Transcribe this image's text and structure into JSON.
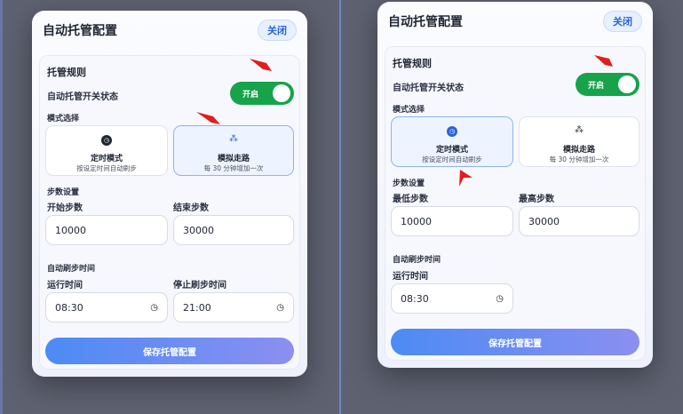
{
  "panels": [
    {
      "title": "自动托管配置",
      "close_label": "关闭",
      "rule_title": "托管规则",
      "switch_label": "自动托管开关状态",
      "switch_text": "开启",
      "mode_label": "模式选择",
      "modes": [
        {
          "name": "定时模式",
          "desc": "按设定时间自动刷步",
          "icon": "clock-icon"
        },
        {
          "name": "模拟走路",
          "desc": "每 30 分钟增加一次",
          "icon": "footsteps-icon"
        }
      ],
      "selected_mode": "模拟走路",
      "steps_title": "步数设置",
      "start_label": "开始步数",
      "start_value": "10000",
      "end_label": "结束步数",
      "end_value": "30000",
      "time_title": "自动刷步时间",
      "run_label": "运行时间",
      "run_value": "08:30",
      "stop_label": "停止刷步时间",
      "stop_value": "21:00",
      "save_label": "保存托管配置"
    },
    {
      "title": "自动托管配置",
      "close_label": "关闭",
      "rule_title": "托管规则",
      "switch_label": "自动托管开关状态",
      "switch_text": "开启",
      "mode_label": "模式选择",
      "modes": [
        {
          "name": "定时模式",
          "desc": "按设定时间自动刷步",
          "icon": "clock-icon"
        },
        {
          "name": "模拟走路",
          "desc": "每 30 分钟增加一次",
          "icon": "footsteps-icon"
        }
      ],
      "selected_mode": "定时模式",
      "steps_title": "步数设置",
      "min_label": "最低步数",
      "min_value": "10000",
      "max_label": "最高步数",
      "max_value": "30000",
      "time_title": "自动刷步时间",
      "run_label": "运行时间",
      "run_value": "08:30",
      "save_label": "保存托管配置"
    }
  ],
  "colors": {
    "toggle_on": "#16a34a",
    "accent": "#2d63d6",
    "annotation_arrow": "#e11d1d"
  }
}
